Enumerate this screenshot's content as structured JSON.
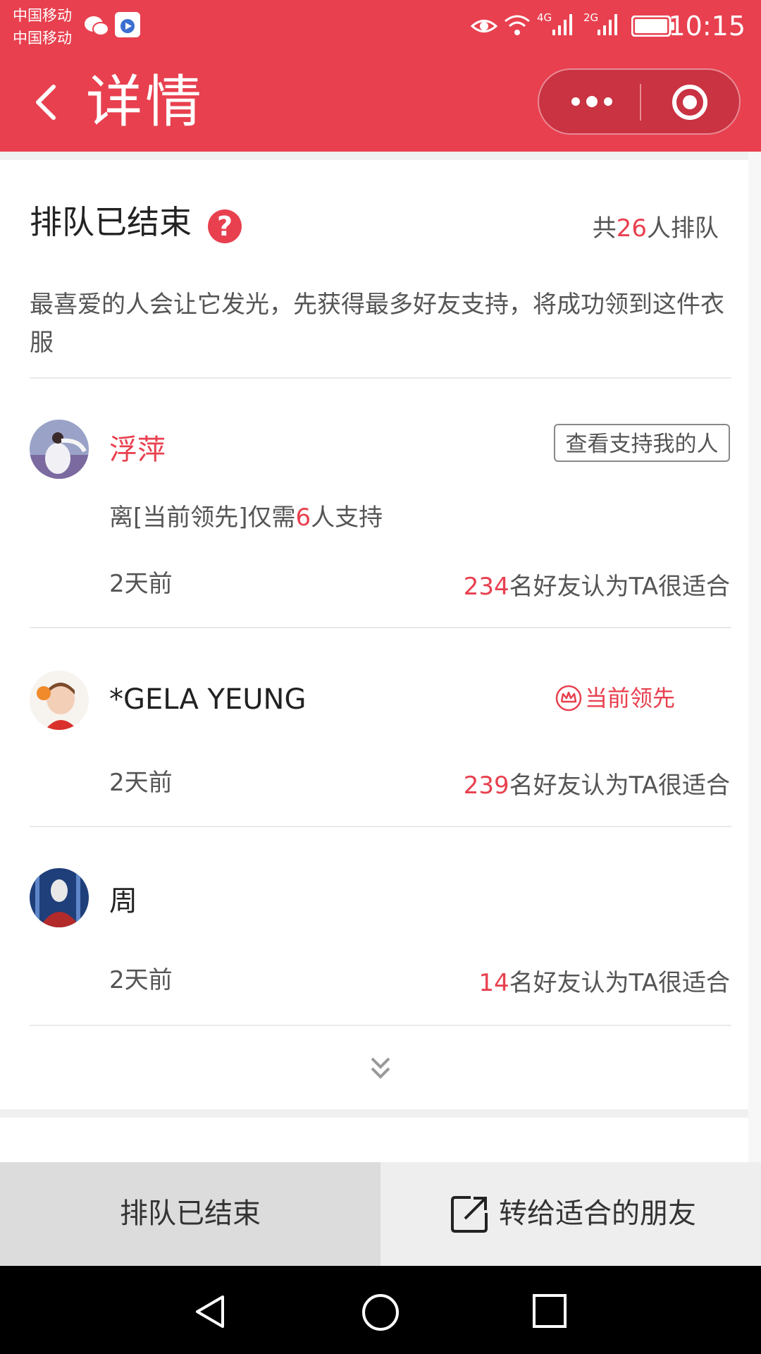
{
  "status_bar": {
    "carrier_1": "中国移动",
    "carrier_2": "中国移动",
    "network_1": "4G",
    "network_2": "2G",
    "time": "10:15",
    "icons": [
      "wechat-icon",
      "app-icon",
      "eye-icon",
      "wifi-icon",
      "signal-icon",
      "signal-icon",
      "battery-icon"
    ]
  },
  "nav": {
    "title": "详情",
    "icons": [
      "back-icon",
      "more-icon",
      "target-icon"
    ]
  },
  "header": {
    "title": "排队已结束",
    "help_symbol": "?",
    "total_prefix": "共",
    "total_count": "26",
    "total_suffix": "人排队",
    "description": "最喜爱的人会让它发光，先获得最多好友支持，将成功领到这件衣服"
  },
  "entries": [
    {
      "name": "浮萍",
      "button": "查看支持我的人",
      "need_prefix": "离[当前领先]仅需",
      "need_count": "6",
      "need_suffix": "人支持",
      "time": "2天前",
      "votes": "234",
      "votes_suffix": "名好友认为TA很适合"
    },
    {
      "name": "*GELA YEUNG",
      "badge": "当前领先",
      "time": "2天前",
      "votes": "239",
      "votes_suffix": "名好友认为TA很适合"
    },
    {
      "name": "周",
      "time": "2天前",
      "votes": "14",
      "votes_suffix": "名好友认为TA很适合"
    }
  ],
  "bottom": {
    "ended_label": "排队已结束",
    "share_label": "转给适合的朋友"
  },
  "colors": {
    "accent": "#e8404f",
    "text": "#333333",
    "muted": "#555555"
  }
}
